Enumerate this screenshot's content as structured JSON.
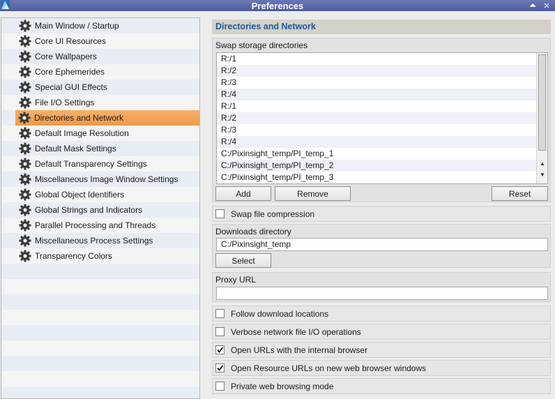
{
  "window": {
    "title": "Preferences"
  },
  "title_buttons": {
    "minimize": "⏶",
    "close": "✕"
  },
  "sidebar": {
    "items": [
      {
        "label": "Main Window / Startup",
        "selected": false
      },
      {
        "label": "Core UI Resources",
        "selected": false
      },
      {
        "label": "Core Wallpapers",
        "selected": false
      },
      {
        "label": "Core Ephemerides",
        "selected": false
      },
      {
        "label": "Special GUI Effects",
        "selected": false
      },
      {
        "label": "File I/O Settings",
        "selected": false
      },
      {
        "label": "Directories and Network",
        "selected": true
      },
      {
        "label": "Default Image Resolution",
        "selected": false
      },
      {
        "label": "Default Mask Settings",
        "selected": false
      },
      {
        "label": "Default Transparency Settings",
        "selected": false
      },
      {
        "label": "Miscellaneous Image Window Settings",
        "selected": false
      },
      {
        "label": "Global Object Identifiers",
        "selected": false
      },
      {
        "label": "Global Strings and Indicators",
        "selected": false
      },
      {
        "label": "Parallel Processing and Threads",
        "selected": false
      },
      {
        "label": "Miscellaneous Process Settings",
        "selected": false
      },
      {
        "label": "Transparency Colors",
        "selected": false
      }
    ]
  },
  "main": {
    "section_title": "Directories and Network",
    "swap": {
      "label": "Swap storage directories",
      "directories": [
        "R:/1",
        "R:/2",
        "R:/3",
        "R:/4",
        "R:/1",
        "R:/2",
        "R:/3",
        "R:/4",
        "C:/Pixinsight_temp/PI_temp_1",
        "C:/Pixinsight_temp/PI_temp_2",
        "C:/Pixinsight_temp/PI_temp_3"
      ],
      "add_label": "Add",
      "remove_label": "Remove",
      "reset_label": "Reset"
    },
    "swap_compression": {
      "label": "Swap file compression",
      "checked": false
    },
    "downloads": {
      "label": "Downloads directory",
      "value": "C:/Pixinsight_temp",
      "select_label": "Select"
    },
    "proxy": {
      "label": "Proxy URL",
      "value": ""
    },
    "options": [
      {
        "label": "Follow download locations",
        "checked": false
      },
      {
        "label": "Verbose network file I/O operations",
        "checked": false
      },
      {
        "label": "Open URLs with the internal browser",
        "checked": true
      },
      {
        "label": "Open Resource URLs on new web browser windows",
        "checked": true
      },
      {
        "label": "Private web browsing mode",
        "checked": false
      }
    ]
  },
  "colors": {
    "title_bar": "#5a67a8",
    "selected_item": "#f2a55a",
    "section_title_text": "#1d5a9e"
  },
  "icons": {
    "sidebar_item": "gear-icon",
    "app": "app-logo-icon"
  }
}
